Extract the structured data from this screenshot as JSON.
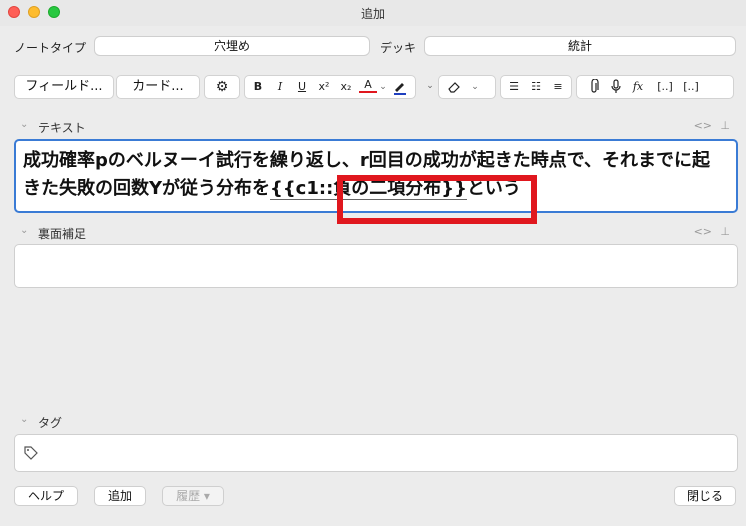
{
  "window": {
    "title": "追加"
  },
  "note_row": {
    "note_type_label": "ノートタイプ",
    "note_type_value": "穴埋め",
    "deck_label": "デッキ",
    "deck_value": "統計"
  },
  "toolbar": {
    "fields_button": "フィールド...",
    "cards_button": "カード...",
    "bold": "B",
    "italic": "I",
    "underline": "U",
    "superscript": "x²",
    "subscript": "x₂",
    "text_color": "A",
    "formula": "fx",
    "cloze": "[..]",
    "cloze_alt": "[..]"
  },
  "fields": [
    {
      "name": "テキスト",
      "text_before": "成功確率pのベルヌーイ試行を繰り返し、r回目の成功が起きた時点で、それまでに起きた失敗の回数Yが従う分布を",
      "cloze_text": "{{c1::負の二項分布}}",
      "text_after": "という"
    },
    {
      "name": "裏面補足",
      "text": ""
    }
  ],
  "tags": {
    "label": "タグ"
  },
  "buttons": {
    "help": "ヘルプ",
    "add": "追加",
    "history": "履歴 ▾",
    "close": "閉じる"
  },
  "colors": {
    "highlight": "#e0171e",
    "focus_border": "#3a7bd5",
    "text_color_underline": "#e0171e",
    "highlighter": "#1f3fbf"
  }
}
